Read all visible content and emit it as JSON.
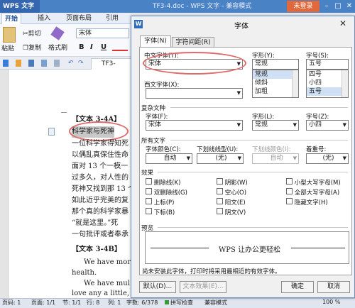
{
  "app": {
    "button": "WPS 文字",
    "title": "TF3-4.doc - WPS 文字 - 兼容模式",
    "login": "未登录"
  },
  "ribbon": {
    "tabs": [
      "开始",
      "插入",
      "页面布局",
      "引用"
    ]
  },
  "toolbar": {
    "cut": "剪切",
    "paste": "粘贴",
    "copy": "复制",
    "format_painter": "格式刷",
    "font": "宋体",
    "bold": "B",
    "italic": "I",
    "underline": "U"
  },
  "doc_tab": {
    "name": "TF3-4.doc"
  },
  "document": {
    "heading_a": "【文本 3-4A】",
    "subtitle_a": "科学家与死神",
    "lines_a": [
      "一位科学家得知死",
      "以偶乱真保住性命",
      "面对 13 个一模一",
      "过多久，对人性的",
      "死神又找到那 13 个",
      "如此近乎完美的复",
      "那个真的科学家暴",
      "“就是这里。”死",
      "一句批评或者奉承"
    ],
    "heading_b": "【文本 3-4B】",
    "lines_b": [
      "We have mor",
      "health.",
      "We have mul",
      "love any a little, "
    ]
  },
  "status": {
    "page": "页码: 1",
    "pages": "页面: 1/1",
    "section": "节: 1/1",
    "row": "行: 8",
    "col": "列: 1",
    "words": "字数: 6/378",
    "spell": "拼写检查",
    "mode": "兼容模式",
    "zoom": "100 %"
  },
  "dialog": {
    "title": "字体",
    "tabs": [
      "字体(N)",
      "字符间距(R)"
    ],
    "cn_font_label": "中文字体(T):",
    "cn_font_value": "宋体",
    "style_label": "字形(Y):",
    "style_value": "常规",
    "style_options": [
      "常规",
      "倾斜",
      "加粗"
    ],
    "size_label": "字号(S):",
    "size_value": "五号",
    "size_options": [
      "四号",
      "小四",
      "五号"
    ],
    "west_font_label": "西文字体(X):",
    "west_font_value": "",
    "complex_section": "复杂文种",
    "complex_font_label": "字体(F):",
    "complex_font_value": "宋体",
    "complex_style_label": "字形(L):",
    "complex_style_value": "常规",
    "complex_size_label": "字号(Z):",
    "complex_size_value": "小四",
    "all_text_section": "所有文字",
    "font_color_label": "字体颜色(C):",
    "font_color_value": "自动",
    "underline_type_label": "下划线线型(U):",
    "underline_type_value": "(无)",
    "underline_color_label": "下划线颜色(I):",
    "underline_color_value": "自动",
    "emphasis_label": "着重号:",
    "emphasis_value": "(无)",
    "effects_section": "效果",
    "effects_col1": [
      "删除线(K)",
      "双删除线(G)",
      "上标(P)",
      "下标(B)"
    ],
    "effects_col2": [
      "阴影(W)",
      "空心(O)",
      "阳文(E)",
      "阴文(V)"
    ],
    "effects_col3": [
      "小型大写字母(M)",
      "全部大写字母(A)",
      "隐藏文字(H)"
    ],
    "preview_section": "预览",
    "preview_text": "WPS 让办公更轻松",
    "preview_note": "尚未安装此字体，打印时将采用最相近的有效字体。",
    "default_button": "默认(D)...",
    "text_effects_button": "文本效果(E)...",
    "ok_button": "确定",
    "cancel_button": "取消"
  },
  "colors": {
    "titlebar": "#4a82c6",
    "login": "#e0683a",
    "annotation": "#e06a6a"
  }
}
